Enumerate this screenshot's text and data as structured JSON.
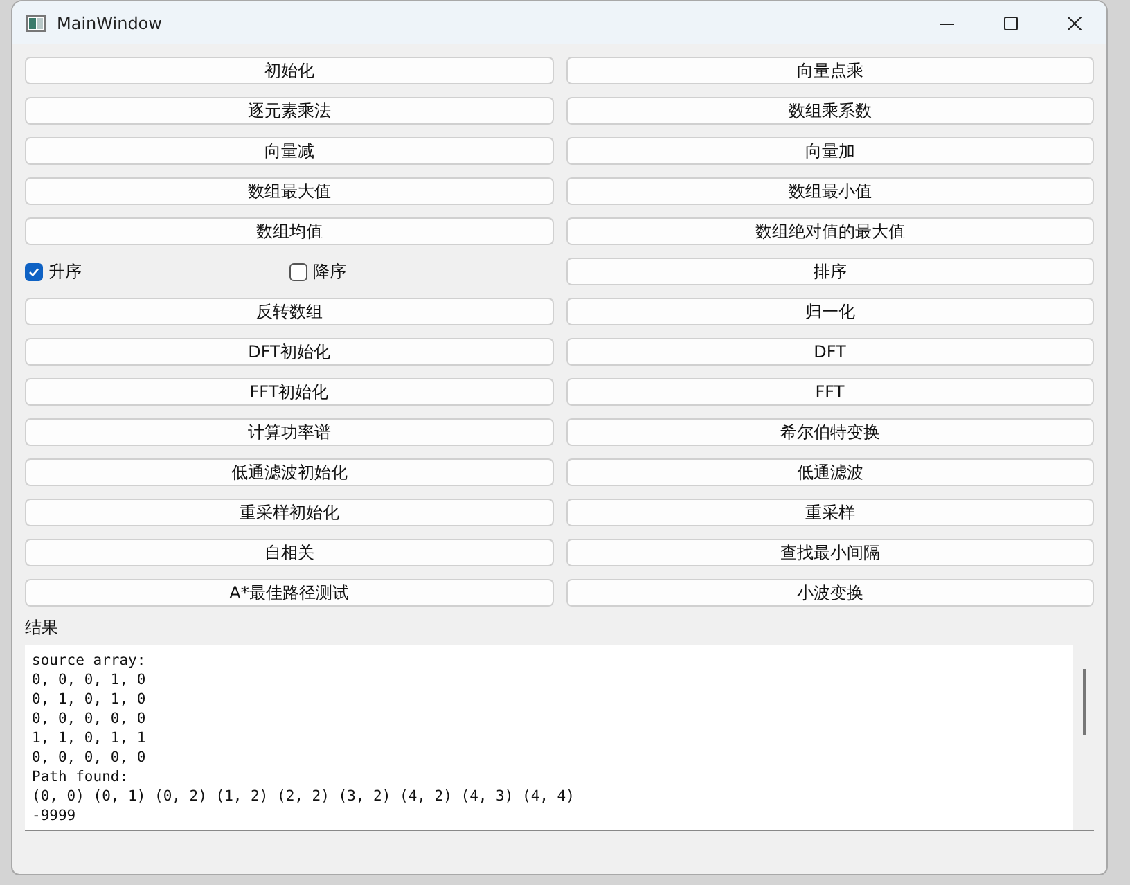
{
  "window": {
    "title": "MainWindow"
  },
  "rows": [
    [
      {
        "kind": "button",
        "label": "初始化"
      },
      {
        "kind": "button",
        "label": "向量点乘"
      }
    ],
    [
      {
        "kind": "button",
        "label": "逐元素乘法"
      },
      {
        "kind": "button",
        "label": "数组乘系数"
      }
    ],
    [
      {
        "kind": "button",
        "label": "向量减"
      },
      {
        "kind": "button",
        "label": "向量加"
      }
    ],
    [
      {
        "kind": "button",
        "label": "数组最大值"
      },
      {
        "kind": "button",
        "label": "数组最小值"
      }
    ],
    [
      {
        "kind": "button",
        "label": "数组均值"
      },
      {
        "kind": "button",
        "label": "数组绝对值的最大值"
      }
    ],
    [
      {
        "kind": "checks",
        "items": [
          {
            "label": "升序",
            "checked": true
          },
          {
            "label": "降序",
            "checked": false
          }
        ]
      },
      {
        "kind": "button",
        "label": "排序"
      }
    ],
    [
      {
        "kind": "button",
        "label": "反转数组"
      },
      {
        "kind": "button",
        "label": "归一化"
      }
    ],
    [
      {
        "kind": "button",
        "label": "DFT初始化"
      },
      {
        "kind": "button",
        "label": "DFT"
      }
    ],
    [
      {
        "kind": "button",
        "label": "FFT初始化"
      },
      {
        "kind": "button",
        "label": "FFT"
      }
    ],
    [
      {
        "kind": "button",
        "label": "计算功率谱"
      },
      {
        "kind": "button",
        "label": "希尔伯特变换"
      }
    ],
    [
      {
        "kind": "button",
        "label": "低通滤波初始化"
      },
      {
        "kind": "button",
        "label": "低通滤波"
      }
    ],
    [
      {
        "kind": "button",
        "label": "重采样初始化"
      },
      {
        "kind": "button",
        "label": "重采样"
      }
    ],
    [
      {
        "kind": "button",
        "label": "自相关"
      },
      {
        "kind": "button",
        "label": "查找最小间隔"
      }
    ],
    [
      {
        "kind": "button",
        "label": "A*最佳路径测试"
      },
      {
        "kind": "button",
        "label": "小波变换"
      }
    ]
  ],
  "result": {
    "label": "结果",
    "lines": [
      "source array:",
      "0, 0, 0, 1, 0",
      "0, 1, 0, 1, 0",
      "0, 0, 0, 0, 0",
      "1, 1, 0, 1, 1",
      "0, 0, 0, 0, 0",
      "Path found:",
      "(0, 0) (0, 1) (0, 2) (1, 2) (2, 2) (3, 2) (4, 2) (4, 3) (4, 4)",
      "-9999"
    ]
  }
}
